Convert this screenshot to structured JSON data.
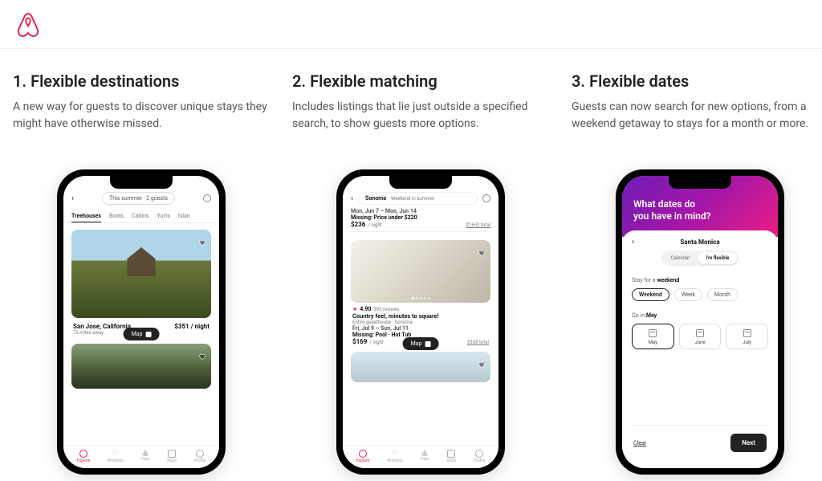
{
  "brand_color": "#e61e4d",
  "sections": [
    {
      "title": "1. Flexible destinations",
      "desc": "A new way for guests to discover unique stays they might have otherwise missed."
    },
    {
      "title": "2. Flexible matching",
      "desc": "Includes listings that lie just outside a specified search, to show guests more options."
    },
    {
      "title": "3. Flexible dates",
      "desc": "Guests can now search for new options, from a weekend getaway to stays for a month or more."
    }
  ],
  "phone1": {
    "search_pill": "This summer · 2 guests",
    "tabs": [
      "Treehouses",
      "Boats",
      "Cabins",
      "Yurts",
      "Islan"
    ],
    "active_tab": "Treehouses",
    "listing": {
      "location": "San Jose, California",
      "price": "$351 / night",
      "distance": "75 miles away"
    },
    "map_button": "Map",
    "nav_items": [
      "Explore",
      "Wishlists",
      "Trips",
      "Inbox",
      "Profile"
    ]
  },
  "phone2": {
    "search_location": "Sonoma",
    "search_when": "Weekend in summer",
    "listing_top": {
      "dates": "Mon, Jun 7 – Mon, Jun 14",
      "missing": "Missing: Price under $220",
      "price": "$236",
      "per": "/ night",
      "total": "$1652 total"
    },
    "listing_main": {
      "rating": "4.90",
      "reviews": "395 reviews",
      "title": "Country feel, minutes to square!",
      "subtitle": "Entire guesthouse · Sonoma",
      "dates": "Fri, Jul 9 – Sun, Jul 11",
      "missing": "Missing: Pool · Hot Tub",
      "price": "$169",
      "per": "/ night",
      "total": "$338 total"
    },
    "map_button": "Map",
    "nav_items": [
      "Explore",
      "Wishlists",
      "Trips",
      "Inbox",
      "Profile"
    ]
  },
  "phone3": {
    "hero_line1": "What dates do",
    "hero_line2": "you have in mind?",
    "sheet_title": "Santa Monica",
    "segment": {
      "calendar": "Calendar",
      "flexible": "I'm flexible"
    },
    "stay_label": "Stay for a weekend",
    "stay_options": [
      "Weekend",
      "Week",
      "Month"
    ],
    "go_label": "Go in May",
    "months": [
      "May",
      "June",
      "July"
    ],
    "clear": "Clear",
    "next": "Next"
  }
}
